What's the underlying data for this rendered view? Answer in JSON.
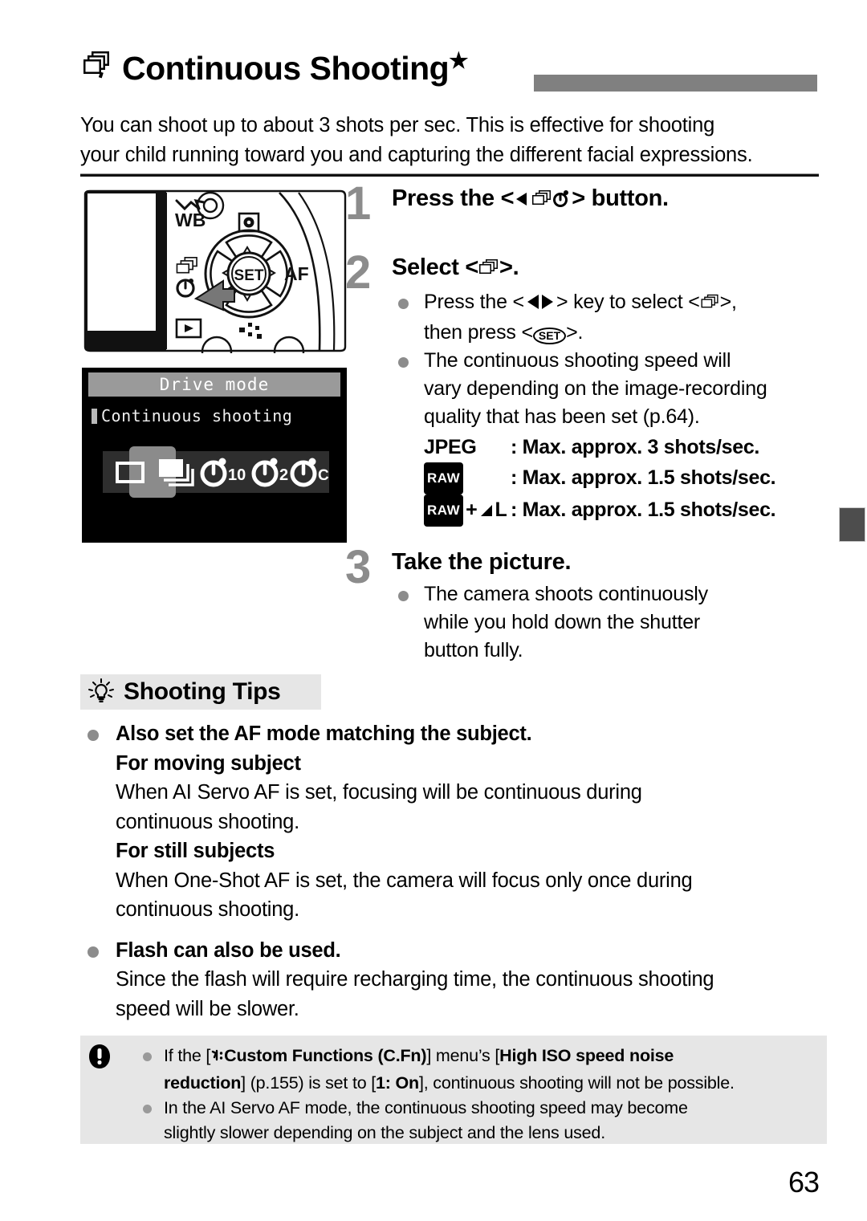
{
  "header": {
    "icon": "continuous-shooting-icon",
    "title": "Continuous Shooting",
    "star": "★",
    "bar_color": "#808080"
  },
  "intro": {
    "line1": "You can shoot up to about 3 shots per sec. This is effective for shooting",
    "line2": "your child running toward you and capturing the different facial expressions."
  },
  "figure": {
    "camera_label_wb": "WB",
    "camera_label_af": "AF",
    "camera_label_set": "SET"
  },
  "lcd": {
    "title": "Drive mode",
    "selected_label": "Continuous shooting",
    "options": [
      {
        "name": "single-shooting-icon",
        "label": "Single shooting",
        "selected": false
      },
      {
        "name": "continuous-shooting-icon",
        "label": "Continuous shooting",
        "selected": true
      },
      {
        "name": "self-timer-10-icon",
        "label": "10",
        "selected": false
      },
      {
        "name": "self-timer-2-icon",
        "label": "2",
        "selected": false
      },
      {
        "name": "self-timer-continuous-icon",
        "label": "C",
        "selected": false
      }
    ]
  },
  "steps": [
    {
      "num": "1",
      "head_pre": "Press the <",
      "head_post": "> button.",
      "bullets": []
    },
    {
      "num": "2",
      "head_pre": "Select <",
      "head_post": ">.",
      "bullets": [
        {
          "pre": "Press the <",
          "mid": "> key to select <",
          "post": ">,",
          "line2": "then press <",
          "line2_post": ">."
        },
        {
          "text": "The continuous shooting speed will vary depending on the image-recording quality that has been set (p.64)."
        }
      ]
    },
    {
      "num": "3",
      "head": "Take the picture.",
      "bullets": [
        {
          "text": "The camera shoots continuously while you hold down the shutter button fully."
        }
      ]
    }
  ],
  "step2_lines": {
    "l1a": "Press the <",
    "l1b": "> key to select <",
    "l1c": ">,",
    "l2a": "then press <",
    "l2b": ">.",
    "l3": "The continuous shooting speed will",
    "l4": "vary depending on the image-recording",
    "l5": "quality that has been set (p.64)."
  },
  "step3_lines": {
    "l1": "The camera shoots continuously",
    "l2": "while you hold down the shutter",
    "l3": "button fully."
  },
  "specs": [
    {
      "label": "JPEG",
      "value": ": Max. approx. 3 shots/sec."
    },
    {
      "label": "RAW",
      "value": ": Max. approx. 1.5 shots/sec."
    },
    {
      "label": "RAW + ◥L",
      "value": ": Max. approx. 1.5 shots/sec."
    }
  ],
  "spec_labels": {
    "jpeg": "JPEG",
    "raw": "RAW",
    "raw_plus_l": "L",
    "plus": "+"
  },
  "tips": {
    "icon": "lightbulb-icon",
    "heading": "Shooting Tips",
    "items": [
      {
        "bold_head": "Also set the AF mode matching the subject.",
        "sub1": "For moving subject",
        "body1a": "When AI Servo AF is set, focusing will be continuous during",
        "body1b": "continuous shooting.",
        "sub2": "For still subjects",
        "body2a": "When One-Shot AF is set, the camera will focus only once during",
        "body2b": "continuous shooting."
      },
      {
        "bold_head": "Flash can also be used.",
        "body1a": "Since the flash will require recharging time, the continuous shooting",
        "body1b": "speed will be slower."
      }
    ]
  },
  "note": {
    "icon": "caution-icon",
    "items": [
      {
        "t1": "If the [",
        "menu_icon": "wrench-setup-icon",
        "t2": "Custom Functions (C.Fn)",
        "t3": "] menu’s [",
        "t4": "High ISO speed noise",
        "t5": "reduction",
        "t6": "] (p.155) is set to [",
        "t7": "1: On",
        "t8": "], continuous shooting will not be possible."
      },
      {
        "l1": "In the AI Servo AF mode, the continuous shooting speed may become",
        "l2": "slightly slower depending on the subject and the lens used."
      }
    ]
  },
  "footer": {
    "page_number": "63"
  },
  "colors": {
    "step_number": "#8c8c8c",
    "bullet": "#8c8c8c",
    "header_bar": "#808080",
    "tips_bg": "#e6e6e6",
    "note_bg": "#e6e6e6",
    "tab_marker": "#4d4d4d",
    "lcd_bg": "#000000",
    "lcd_title_bg": "#9a9a9a"
  }
}
